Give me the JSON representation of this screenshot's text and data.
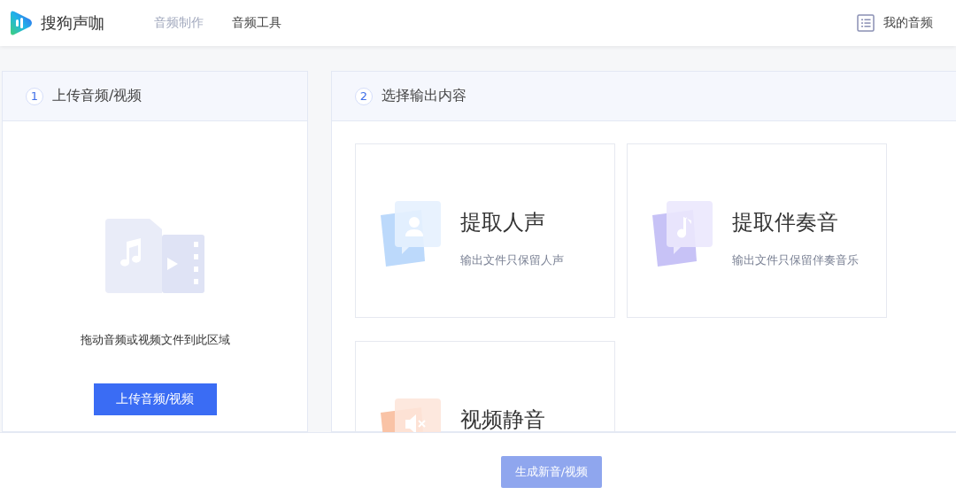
{
  "header": {
    "logo_text": "搜狗声咖",
    "nav": [
      {
        "label": "音频制作",
        "selected": true
      },
      {
        "label": "音频工具",
        "selected": false
      }
    ],
    "my_audio": "我的音频"
  },
  "upload_panel": {
    "step": "1",
    "title": "上传音频/视频",
    "hint": "拖动音频或视频文件到此区域",
    "button": "上传音频/视频"
  },
  "output_panel": {
    "step": "2",
    "title": "选择输出内容",
    "options": [
      {
        "kind": "voice",
        "title": "提取人声",
        "description": "输出文件只保留人声"
      },
      {
        "kind": "accompaniment",
        "title": "提取伴奏音",
        "description": "输出文件只保留伴奏音乐"
      },
      {
        "kind": "mute",
        "title": "视频静音"
      }
    ]
  },
  "footer": {
    "button": "生成新音/视频",
    "disabled": true
  }
}
